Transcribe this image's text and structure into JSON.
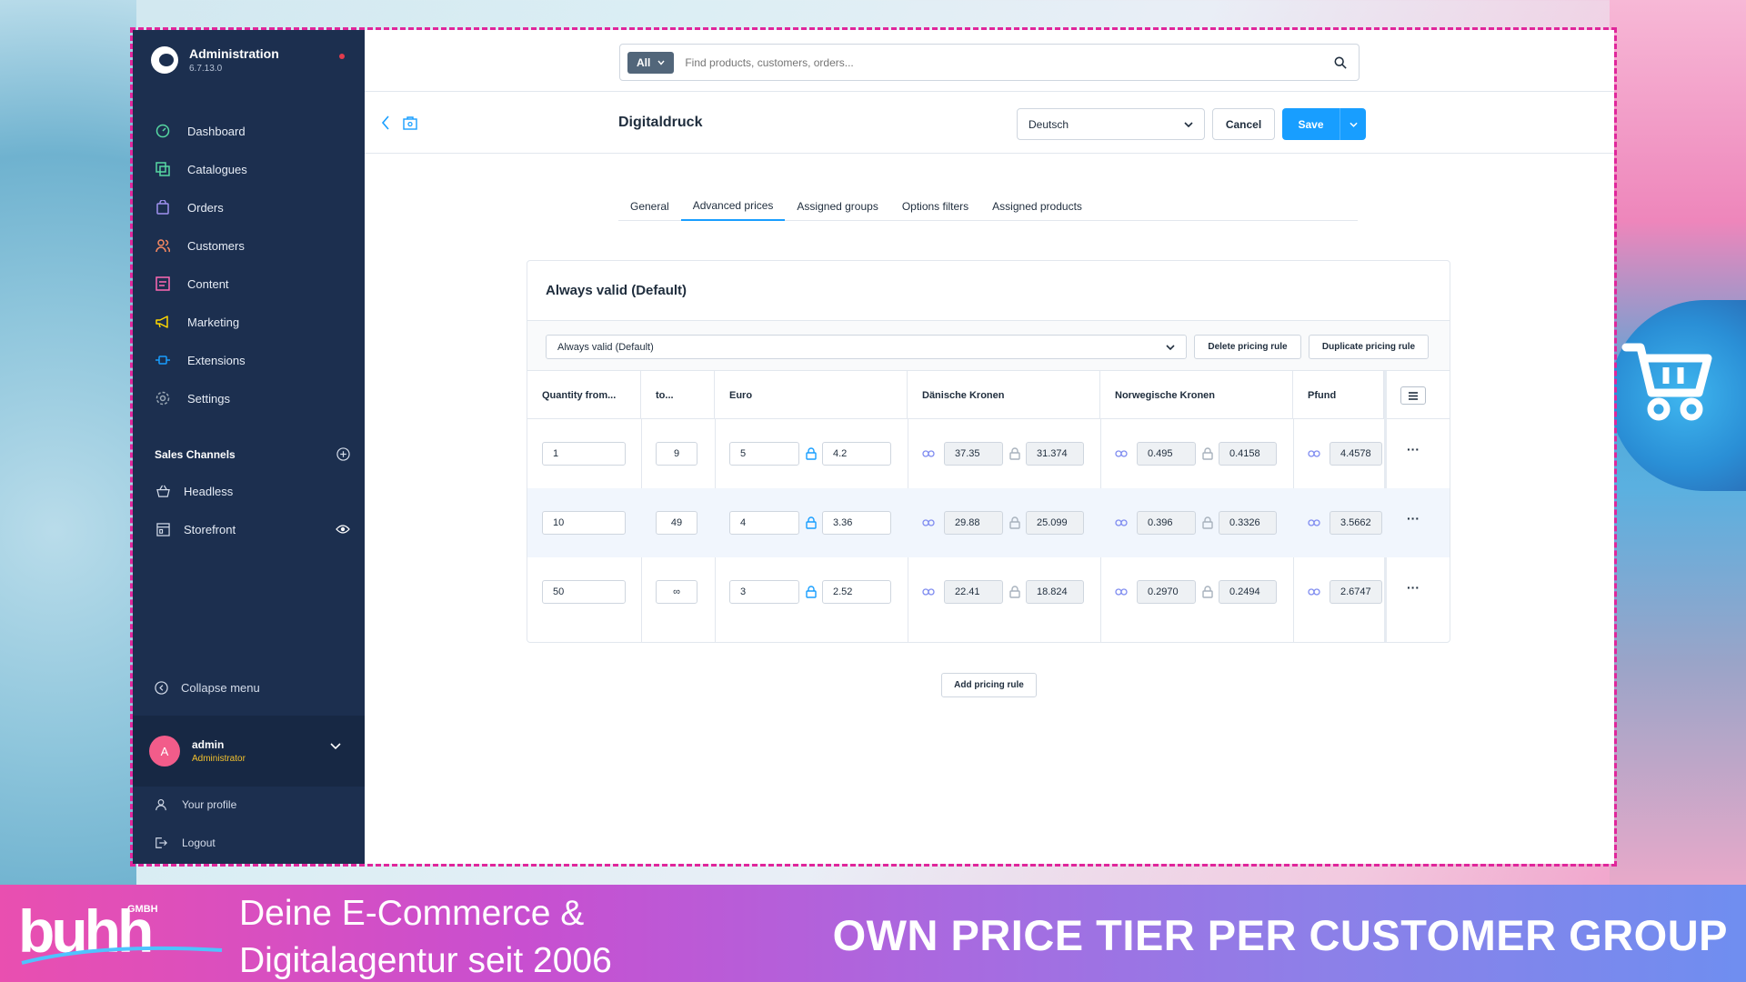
{
  "app": {
    "title": "Administration",
    "version": "6.7.13.0"
  },
  "sidebar": {
    "items": [
      {
        "label": "Dashboard",
        "icon": "dashboard-icon",
        "color": "#57d9a3"
      },
      {
        "label": "Catalogues",
        "icon": "catalogue-icon",
        "color": "#57d9a3"
      },
      {
        "label": "Orders",
        "icon": "orders-bag-icon",
        "color": "#a092f0"
      },
      {
        "label": "Customers",
        "icon": "customers-icon",
        "color": "#f88962"
      },
      {
        "label": "Content",
        "icon": "content-icon",
        "color": "#ff68b4"
      },
      {
        "label": "Marketing",
        "icon": "marketing-megaphone-icon",
        "color": "#ffd700"
      },
      {
        "label": "Extensions",
        "icon": "extensions-plug-icon",
        "color": "#189eff"
      },
      {
        "label": "Settings",
        "icon": "settings-gear-icon",
        "color": "#9aa8b5"
      }
    ],
    "sales_channels_header": "Sales Channels",
    "sales_channels": [
      {
        "label": "Headless"
      },
      {
        "label": "Storefront"
      }
    ],
    "collapse_label": "Collapse menu",
    "user": {
      "initial": "A",
      "name": "admin",
      "role": "Administrator"
    },
    "profile_label": "Your profile",
    "logout_label": "Logout"
  },
  "search": {
    "type_label": "All",
    "placeholder": "Find products, customers, orders..."
  },
  "page": {
    "title": "Digitaldruck",
    "language": "Deutsch",
    "cancel_label": "Cancel",
    "save_label": "Save"
  },
  "tabs": [
    {
      "label": "General",
      "active": false
    },
    {
      "label": "Advanced prices",
      "active": true
    },
    {
      "label": "Assigned groups",
      "active": false
    },
    {
      "label": "Options filters",
      "active": false
    },
    {
      "label": "Assigned products",
      "active": false
    }
  ],
  "pricing": {
    "card_title": "Always valid (Default)",
    "rule_select": "Always valid (Default)",
    "delete_label": "Delete pricing rule",
    "duplicate_label": "Duplicate pricing rule",
    "columns": {
      "qty_from": "Quantity from...",
      "qty_to": "to...",
      "euro": "Euro",
      "dkk": "Dänische Kronen",
      "nok": "Norwegische Kronen",
      "gbp": "Pfund"
    },
    "rows": [
      {
        "from": "1",
        "to": "9",
        "eur_gross": "5",
        "eur_net": "4.2",
        "dkk_gross": "37.35",
        "dkk_net": "31.374",
        "nok_gross": "0.495",
        "nok_net": "0.4158",
        "gbp_gross": "4.4578"
      },
      {
        "from": "10",
        "to": "49",
        "eur_gross": "4",
        "eur_net": "3.36",
        "dkk_gross": "29.88",
        "dkk_net": "25.099",
        "nok_gross": "0.396",
        "nok_net": "0.3326",
        "gbp_gross": "3.5662"
      },
      {
        "from": "50",
        "to": "∞",
        "eur_gross": "3",
        "eur_net": "2.52",
        "dkk_gross": "22.41",
        "dkk_net": "18.824",
        "nok_gross": "0.2970",
        "nok_net": "0.2494",
        "gbp_gross": "2.6747"
      }
    ],
    "row_actions": "···",
    "add_rule_label": "Add pricing rule"
  },
  "banner": {
    "logo_text": "buhh",
    "logo_sub": "GMBH",
    "tagline_line1": "Deine E-Commerce &",
    "tagline_line2": "Digitalagentur seit 2006",
    "claim": "OWN PRICE TIER PER CUSTOMER GROUP"
  },
  "colors": {
    "accent": "#189eff",
    "sidebar": "#1c2f4f",
    "frame_border": "#e0269b"
  }
}
